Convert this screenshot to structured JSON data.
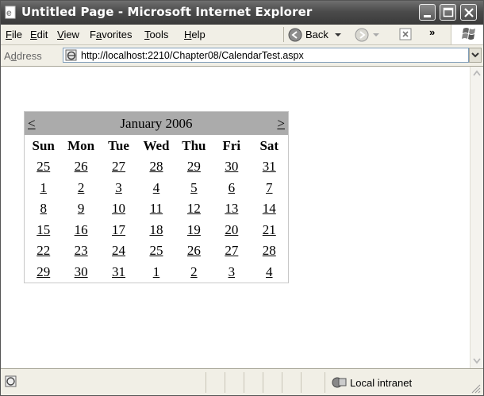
{
  "window": {
    "title": "Untitled Page - Microsoft Internet Explorer"
  },
  "menubar": {
    "items": [
      {
        "label": "File",
        "mnemonic": "F",
        "rest": "ile"
      },
      {
        "label": "Edit",
        "mnemonic": "E",
        "rest": "dit"
      },
      {
        "label": "View",
        "mnemonic": "V",
        "rest": "iew"
      },
      {
        "label": "Favorites",
        "pre": "F",
        "mnemonic": "a",
        "rest": "vorites"
      },
      {
        "label": "Tools",
        "mnemonic": "T",
        "rest": "ools"
      },
      {
        "label": "Help",
        "mnemonic": "H",
        "rest": "elp"
      }
    ],
    "back_label": "Back",
    "more_label": "»"
  },
  "address": {
    "label": "Address",
    "label_pre": "A",
    "label_mnemonic": "d",
    "label_rest": "dress",
    "url": "http://localhost:2210/Chapter08/CalendarTest.aspx"
  },
  "calendar": {
    "prev": "<",
    "next": ">",
    "title": "January 2006",
    "day_headers": [
      "Sun",
      "Mon",
      "Tue",
      "Wed",
      "Thu",
      "Fri",
      "Sat"
    ],
    "weeks": [
      [
        "25",
        "26",
        "27",
        "28",
        "29",
        "30",
        "31"
      ],
      [
        "1",
        "2",
        "3",
        "4",
        "5",
        "6",
        "7"
      ],
      [
        "8",
        "9",
        "10",
        "11",
        "12",
        "13",
        "14"
      ],
      [
        "15",
        "16",
        "17",
        "18",
        "19",
        "20",
        "21"
      ],
      [
        "22",
        "23",
        "24",
        "25",
        "26",
        "27",
        "28"
      ],
      [
        "29",
        "30",
        "31",
        "1",
        "2",
        "3",
        "4"
      ]
    ]
  },
  "statusbar": {
    "zone": "Local intranet"
  },
  "colors": {
    "calendar_header": "#ababab",
    "titlebar": "#4b4b4b"
  }
}
